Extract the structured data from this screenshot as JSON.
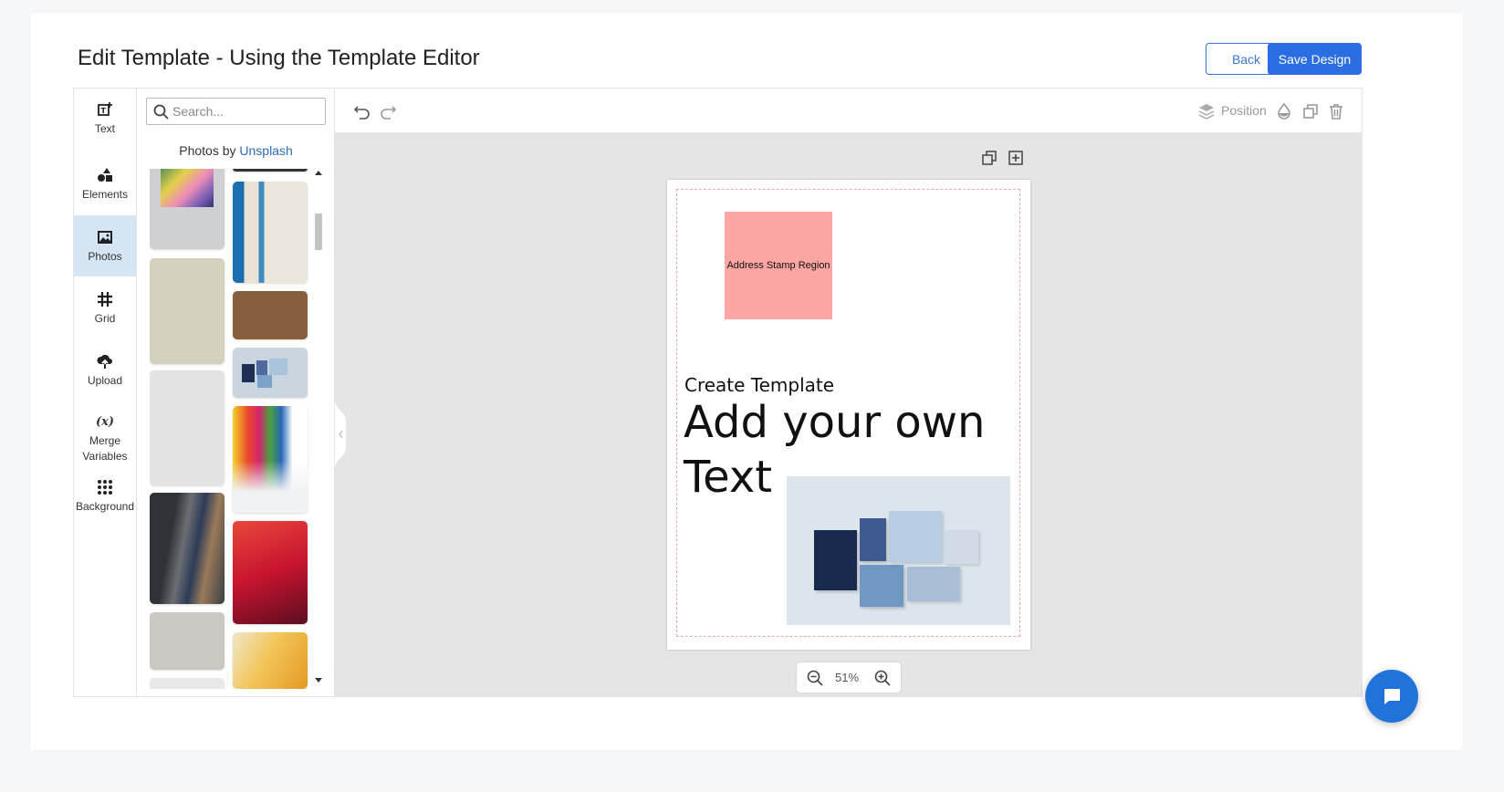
{
  "header": {
    "title": "Edit Template - Using the Template Editor",
    "back_label": "Back",
    "save_label": "Save Design"
  },
  "nav": {
    "items": [
      {
        "label": "Text",
        "icon": "text-add-icon"
      },
      {
        "label": "Elements",
        "icon": "shapes-icon"
      },
      {
        "label": "Photos",
        "icon": "image-icon",
        "active": true
      },
      {
        "label": "Grid",
        "icon": "grid-icon"
      },
      {
        "label": "Upload",
        "icon": "upload-cloud-icon"
      },
      {
        "label": "Merge\nVariables",
        "icon": "variable-icon"
      },
      {
        "label": "Background",
        "icon": "dots-grid-icon"
      }
    ]
  },
  "panel": {
    "search_placeholder": "Search...",
    "credit_prefix": "Photos by",
    "credit_link": "Unsplash"
  },
  "toolbar": {
    "position_label": "Position"
  },
  "canvas": {
    "stamp_label": "Address Stamp Region",
    "subtitle": "Create Template",
    "headline": "Add your own Text",
    "zoom_value": "51%"
  },
  "colors": {
    "accent": "#2b6de2",
    "stamp": "#fca6a3",
    "active_nav": "#d5e5f3"
  }
}
